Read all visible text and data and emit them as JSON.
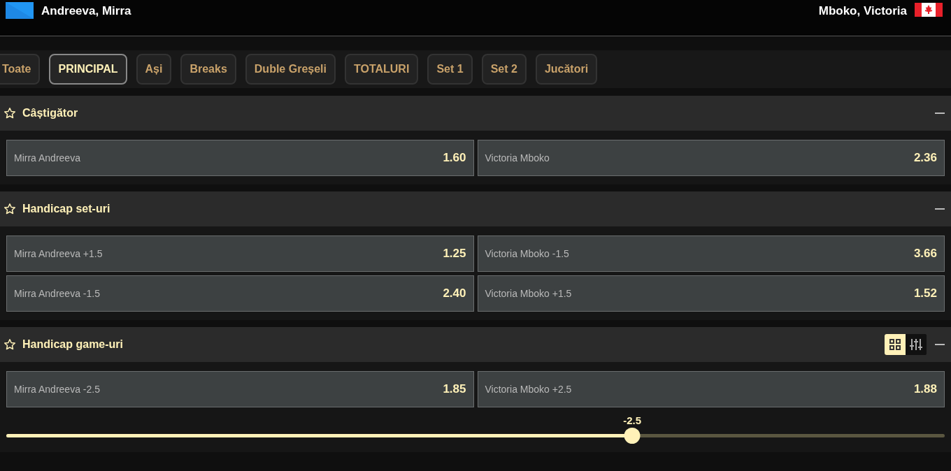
{
  "header": {
    "home": {
      "name": "Andreeva, Mirra"
    },
    "away": {
      "name": "Mboko, Victoria"
    }
  },
  "tabs": [
    {
      "label": "Toate",
      "selected": false
    },
    {
      "label": "PRINCIPAL",
      "selected": true
    },
    {
      "label": "Ași",
      "selected": false
    },
    {
      "label": "Breaks",
      "selected": false
    },
    {
      "label": "Duble Greșeli",
      "selected": false
    },
    {
      "label": "TOTALURI",
      "selected": false
    },
    {
      "label": "Set 1",
      "selected": false
    },
    {
      "label": "Set 2",
      "selected": false
    },
    {
      "label": "Jucători",
      "selected": false
    }
  ],
  "markets": [
    {
      "title": "Câștigător",
      "favorite": false,
      "expanded": true,
      "rows": [
        [
          {
            "label": "Mirra Andreeva",
            "odds": "1.60"
          },
          {
            "label": "Victoria Mboko",
            "odds": "2.36"
          }
        ]
      ]
    },
    {
      "title": "Handicap set-uri",
      "favorite": false,
      "expanded": true,
      "rows": [
        [
          {
            "label": "Mirra Andreeva +1.5",
            "odds": "1.25"
          },
          {
            "label": "Victoria Mboko -1.5",
            "odds": "3.66"
          }
        ],
        [
          {
            "label": "Mirra Andreeva -1.5",
            "odds": "2.40"
          },
          {
            "label": "Victoria Mboko +1.5",
            "odds": "1.52"
          }
        ]
      ]
    },
    {
      "title": "Handicap game-uri",
      "favorite": false,
      "expanded": true,
      "view_toggle": [
        {
          "kind": "grid",
          "selected": true
        },
        {
          "kind": "sliders",
          "selected": false
        }
      ],
      "rows": [
        [
          {
            "label": "Mirra Andreeva -2.5",
            "odds": "1.85"
          },
          {
            "label": "Victoria Mboko +2.5",
            "odds": "1.88"
          }
        ]
      ],
      "slider": {
        "value": "-2.5",
        "level": 0.667
      }
    }
  ]
}
